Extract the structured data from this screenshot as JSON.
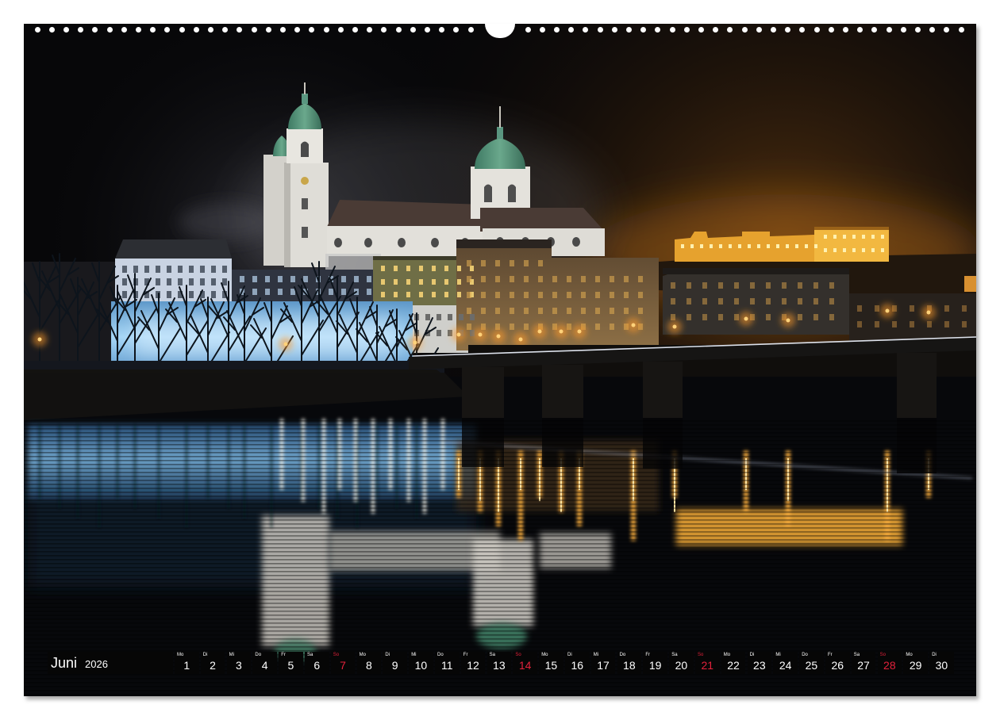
{
  "calendar": {
    "month": "Juni",
    "year": "2026",
    "days": [
      {
        "wd": "Mo",
        "num": "1"
      },
      {
        "wd": "Di",
        "num": "2"
      },
      {
        "wd": "Mi",
        "num": "3"
      },
      {
        "wd": "Do",
        "num": "4"
      },
      {
        "wd": "Fr",
        "num": "5"
      },
      {
        "wd": "Sa",
        "num": "6"
      },
      {
        "wd": "So",
        "num": "7",
        "red": true
      },
      {
        "wd": "Mo",
        "num": "8"
      },
      {
        "wd": "Di",
        "num": "9"
      },
      {
        "wd": "Mi",
        "num": "10"
      },
      {
        "wd": "Do",
        "num": "11"
      },
      {
        "wd": "Fr",
        "num": "12"
      },
      {
        "wd": "Sa",
        "num": "13"
      },
      {
        "wd": "So",
        "num": "14",
        "red": true
      },
      {
        "wd": "Mo",
        "num": "15"
      },
      {
        "wd": "Di",
        "num": "16"
      },
      {
        "wd": "Mi",
        "num": "17"
      },
      {
        "wd": "Do",
        "num": "18"
      },
      {
        "wd": "Fr",
        "num": "19"
      },
      {
        "wd": "Sa",
        "num": "20"
      },
      {
        "wd": "So",
        "num": "21",
        "red": true
      },
      {
        "wd": "Mo",
        "num": "22"
      },
      {
        "wd": "Di",
        "num": "23"
      },
      {
        "wd": "Mi",
        "num": "24"
      },
      {
        "wd": "Do",
        "num": "25"
      },
      {
        "wd": "Fr",
        "num": "26"
      },
      {
        "wd": "Sa",
        "num": "27"
      },
      {
        "wd": "So",
        "num": "28",
        "red": true
      },
      {
        "wd": "Mo",
        "num": "29"
      },
      {
        "wd": "Di",
        "num": "30"
      }
    ]
  },
  "colors": {
    "sunday": "#e2213b",
    "text": "#ffffff",
    "strip": "#060606",
    "paper": "#ffffff"
  }
}
